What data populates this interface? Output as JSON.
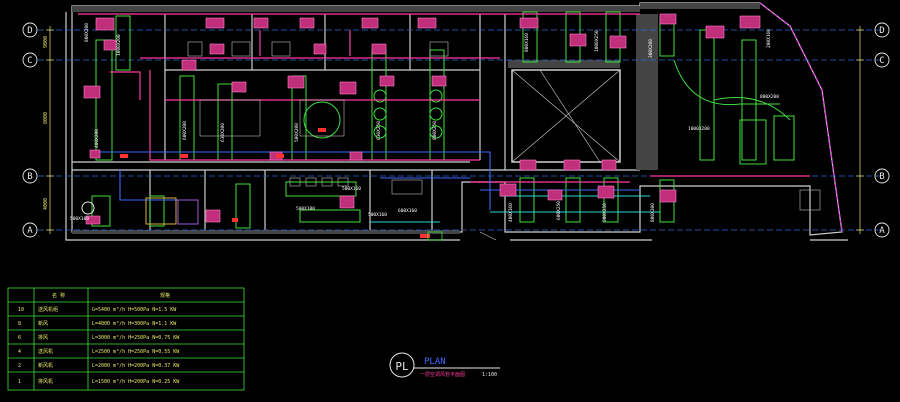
{
  "grid_axes": [
    "D",
    "C",
    "B",
    "A"
  ],
  "dims_left": [
    "9000",
    "8000",
    "4000"
  ],
  "duct_labels": [
    "800X200",
    "1000X200",
    "600X200",
    "630X200",
    "500X200",
    "500X160",
    "500X100",
    "630X250",
    "800X250",
    "400X200",
    "800X160",
    "1000X250",
    "300X200",
    "200X160",
    "400X160",
    "600X250",
    "500X250",
    "800X200",
    "1000X200",
    "600X160"
  ],
  "legend": {
    "header": [
      "",
      "名 称",
      "规格"
    ],
    "rows": [
      {
        "num": "10",
        "name": "送风机组",
        "spec": "G=5400 m³/h H=500Pa N=1.5 KW"
      },
      {
        "num": "8",
        "name": "新风",
        "spec": "L=4000 m³/h H=300Pa N=1.1 KW"
      },
      {
        "num": "6",
        "name": "排风",
        "spec": "L=3000 m³/h H=250Pa N=0.75 KW"
      },
      {
        "num": "4",
        "name": "送风机",
        "spec": "L=2500 m³/h H=250Pa N=0.55 KW"
      },
      {
        "num": "2",
        "name": "新风机",
        "spec": "L=2000 m³/h H=200Pa N=0.37 KW"
      },
      {
        "num": "1",
        "name": "排风机",
        "spec": "L=1500 m³/h H=200Pa N=0.25 KW"
      }
    ]
  },
  "title_block": {
    "symbol": "PL",
    "title": "PLAN",
    "subtitle": "一层空调风管平面图",
    "scale": "1:100"
  }
}
